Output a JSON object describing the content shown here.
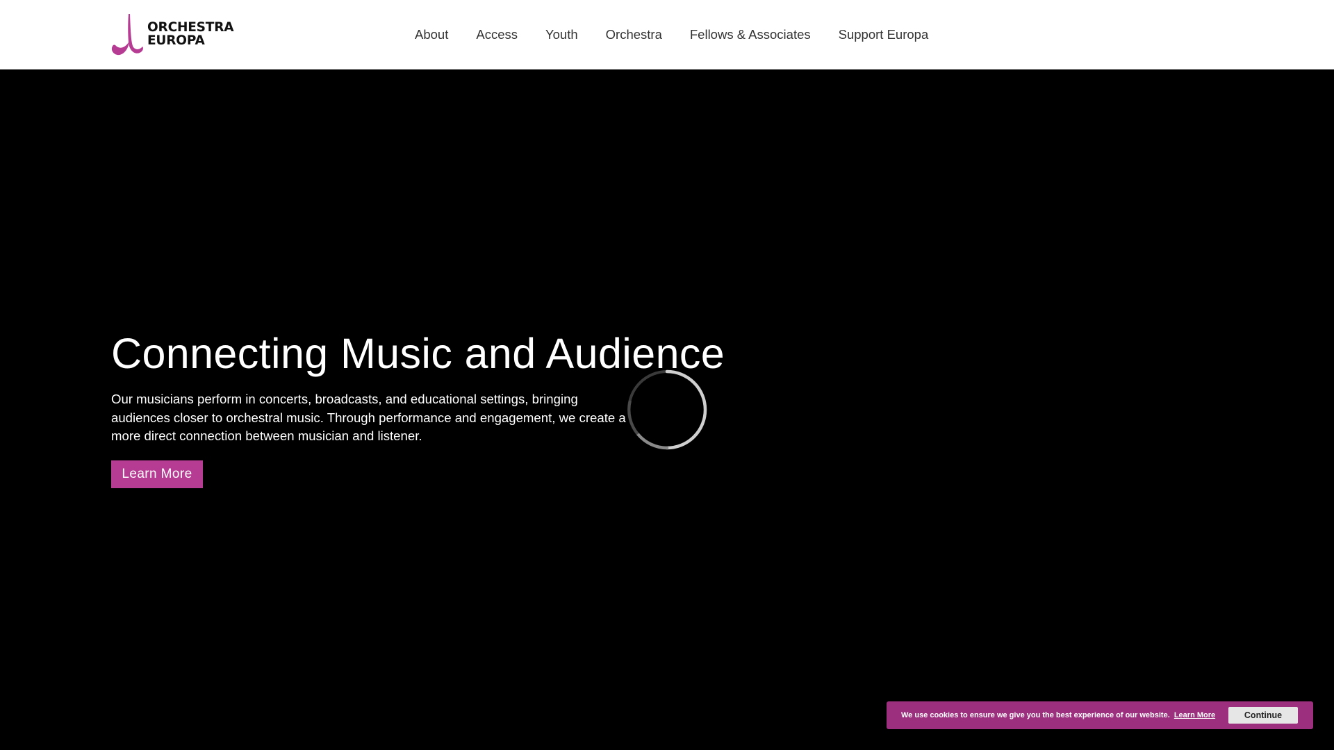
{
  "header": {
    "logo": {
      "line1": "ORCHESTRA",
      "line2": "EUROPA",
      "mark_color": "#b63b93"
    },
    "nav": [
      {
        "label": "About"
      },
      {
        "label": "Access"
      },
      {
        "label": "Youth"
      },
      {
        "label": "Orchestra"
      },
      {
        "label": "Fellows & Associates"
      },
      {
        "label": "Support Europa"
      }
    ]
  },
  "hero": {
    "title": "Connecting Music and Audience",
    "body": "Our musicians perform in concerts, broadcasts, and educational settings, bringing audiences closer to orchestral music. Through performance and engagement, we create a more direct connection between musician and listener.",
    "button_label": "Learn More",
    "loading_indicator": "spinner-icon"
  },
  "cookie_banner": {
    "message": "We use cookies to ensure we give you the best experience of our website.",
    "link_label": "Learn More",
    "button_label": "Continue"
  },
  "colors": {
    "brand": "#b63b93",
    "cookie_bg": "#9c2f7e",
    "hero_bg": "#000000",
    "header_bg": "#ffffff"
  }
}
